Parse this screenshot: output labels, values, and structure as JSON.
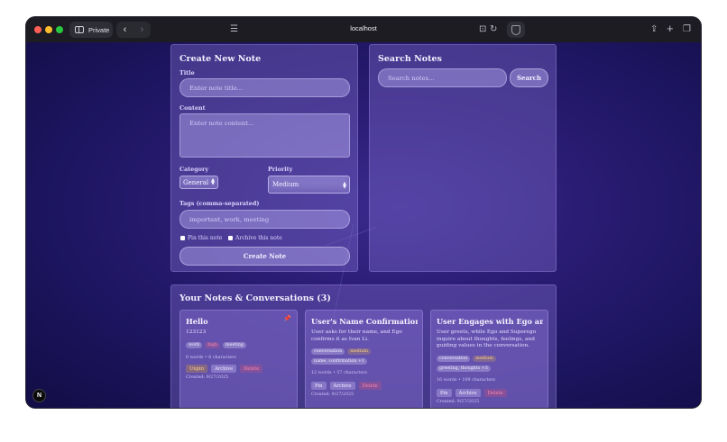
{
  "browser": {
    "mode_label": "Private",
    "url": "localhost",
    "back_glyph": "‹",
    "forward_glyph": "›"
  },
  "create_form": {
    "heading": "Create New Note",
    "title_label": "Title",
    "title_placeholder": "Enter note title...",
    "content_label": "Content",
    "content_placeholder": "Enter note content...",
    "category_label": "Category",
    "category_value": "General",
    "priority_label": "Priority",
    "priority_value": "Medium",
    "tags_label": "Tags (comma-separated)",
    "tags_placeholder": "important, work, meeting",
    "pin_label": "Pin this note",
    "archive_label": "Archive this note",
    "submit_label": "Create Note"
  },
  "search": {
    "heading": "Search Notes",
    "placeholder": "Search notes...",
    "button_label": "Search"
  },
  "notes_section": {
    "heading": "Your Notes & Conversations (3)",
    "notes": [
      {
        "title": "Hello",
        "body": "123123",
        "pinned": true,
        "tags": [
          "work",
          "high",
          "meeting"
        ],
        "meta": "0 words • 6 characters",
        "actions": [
          "Unpin",
          "Archive",
          "Delete"
        ],
        "created": "Created: 9/27/2025"
      },
      {
        "title": "User's Name Confirmation",
        "body": "User asks for their name, and Ego confirms it as Ivan Li.",
        "tags": [
          "conversation",
          "medium"
        ],
        "tags2": [
          "name, confirmation +1"
        ],
        "meta": "12 words • 57 characters",
        "actions": [
          "Pin",
          "Archive",
          "Delete"
        ],
        "created": "Created: 9/27/2025"
      },
      {
        "title": "User Engages with Ego and ...",
        "body": "User greets, while Ego and Superego inquire about thoughts, feelings, and guiding values in the conversation.",
        "tags": [
          "conversation",
          "medium"
        ],
        "tags2": [
          "greeting, thoughts +3"
        ],
        "meta": "16 words • 109 characters",
        "actions": [
          "Pin",
          "Archive",
          "Delete"
        ],
        "created": "Created: 9/27/2025"
      }
    ]
  },
  "dev_badge": "N",
  "colors": {
    "traffic_red": "#ff5f57",
    "traffic_yellow": "#febc2e",
    "traffic_green": "#28c840",
    "accent_high": "#ff8aa6",
    "accent_medium": "#ffd27a"
  }
}
